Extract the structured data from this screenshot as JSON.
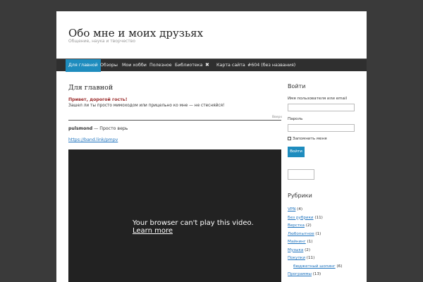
{
  "site": {
    "title": "Обо мне и моих друзьях",
    "description": "Общение, наука и творчество"
  },
  "nav": {
    "items": [
      {
        "label": "Для главной",
        "active": true
      },
      {
        "label": "Обзоры"
      },
      {
        "label": "Мои хобби"
      },
      {
        "label": "Полезное"
      },
      {
        "label": "Библиотека"
      },
      {
        "label": "✖",
        "icon": "close-icon"
      },
      {
        "label": "Карта сайта"
      },
      {
        "label": "#604 (без названия)"
      }
    ]
  },
  "main": {
    "title": "Для главной",
    "greeting_title": "Привет, дорогой гость!",
    "greeting_text": "Зашел ли ты просто мимоходом или прицельно ко мне — не стесняйся!",
    "top_link": "Вверх",
    "post": {
      "author": "pulsmond",
      "separator": " — ",
      "excerpt": "Просто верь",
      "link": "https://band.link/pmpv"
    },
    "video": {
      "message": "Your browser can't play this video.",
      "learn_more": "Learn more"
    }
  },
  "sidebar": {
    "login": {
      "heading": "Войти",
      "username_label": "Имя пользователя или email",
      "password_label": "Пароль",
      "remember_label": "Запомнить меня",
      "submit_label": "Войти"
    },
    "categories": {
      "heading": "Рубрики",
      "items": [
        {
          "name": "VPN",
          "count": "(4)"
        },
        {
          "name": "Без рубрики",
          "count": "(11)"
        },
        {
          "name": "Верстка",
          "count": "(2)"
        },
        {
          "name": "Любопытное",
          "count": "(1)"
        },
        {
          "name": "Майнинг",
          "count": "(1)"
        },
        {
          "name": "Музыка",
          "count": "(2)"
        },
        {
          "name": "Покупки",
          "count": "(11)"
        },
        {
          "name": "бюджетный шопинг",
          "count": "(6)",
          "sub": true
        },
        {
          "name": "Программы",
          "count": "(13)"
        }
      ]
    }
  },
  "colors": {
    "background": "#3a3a3a",
    "nav_bg": "#2f2f2f",
    "accent": "#1e8cbe",
    "greeting": "#9b2a2a",
    "link": "#1e73be"
  }
}
